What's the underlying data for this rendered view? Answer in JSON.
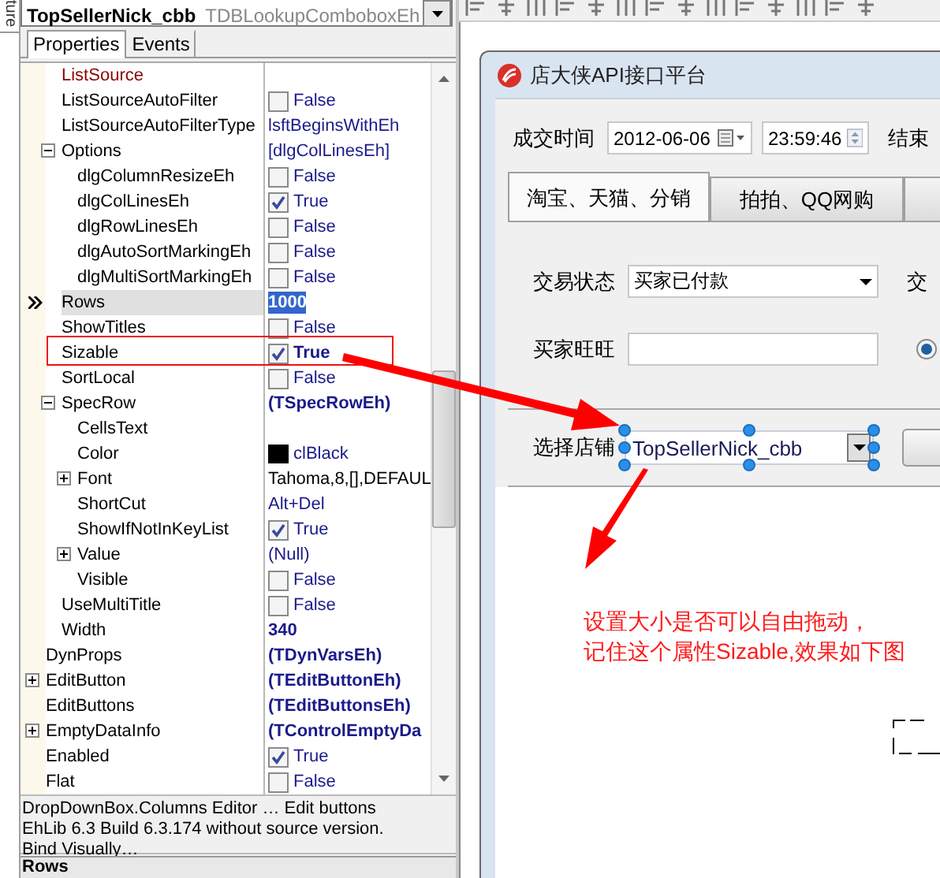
{
  "side_tab": {
    "label": "ture"
  },
  "inspector": {
    "object": "TopSellerNick_cbb",
    "type": "TDBLookupComboboxEh",
    "tabs": [
      {
        "label": "Properties",
        "selected": true
      },
      {
        "label": "Events",
        "selected": false
      }
    ],
    "properties": [
      {
        "children": [
          {
            "name": "ListSource",
            "kind": "link",
            "selected": false
          },
          {
            "name": "ListSourceAutoFilter",
            "kind": "check",
            "checked": false,
            "modified": false,
            "value": "False",
            "selected": false
          },
          {
            "name": "ListSourceAutoFilterType",
            "kind": "text",
            "value": "lsftBeginsWithEh",
            "selected": false
          },
          {
            "name": "Options",
            "kind": "text",
            "value": "[dlgColLinesEh]",
            "expanded": true,
            "selected": false,
            "children": [
              {
                "name": "dlgColumnResizeEh",
                "kind": "check",
                "checked": false,
                "modified": false,
                "value": "False",
                "selected": false
              },
              {
                "name": "dlgColLinesEh",
                "kind": "check",
                "checked": true,
                "modified": false,
                "value": "True",
                "selected": false
              },
              {
                "name": "dlgRowLinesEh",
                "kind": "check",
                "checked": false,
                "modified": false,
                "value": "False",
                "selected": false
              },
              {
                "name": "dlgAutoSortMarkingEh",
                "kind": "check",
                "checked": false,
                "modified": false,
                "value": "False",
                "selected": false
              },
              {
                "name": "dlgMultiSortMarkingEh",
                "kind": "check",
                "checked": false,
                "modified": false,
                "value": "False",
                "selected": false
              }
            ]
          },
          {
            "name": "Rows",
            "kind": "text",
            "value": "1000",
            "selected": true
          },
          {
            "name": "ShowTitles",
            "kind": "check",
            "checked": false,
            "modified": false,
            "value": "False",
            "selected": false
          },
          {
            "name": "Sizable",
            "kind": "check",
            "checked": true,
            "modified": true,
            "value": "True",
            "selected": false
          },
          {
            "name": "SortLocal",
            "kind": "check",
            "checked": false,
            "modified": false,
            "value": "False",
            "selected": false
          },
          {
            "name": "SpecRow",
            "kind": "bold",
            "value": "(TSpecRowEh)",
            "expanded": true,
            "selected": false,
            "children": [
              {
                "name": "CellsText",
                "kind": "text",
                "selected": false
              },
              {
                "name": "Color",
                "kind": "color",
                "value": "clBlack",
                "selected": false
              },
              {
                "name": "Font",
                "kind": "plain",
                "value": "Tahoma,8,[],DEFAUL",
                "expanded": false,
                "selected": false
              },
              {
                "name": "ShortCut",
                "kind": "text",
                "value": "Alt+Del",
                "selected": false
              },
              {
                "name": "ShowIfNotInKeyList",
                "kind": "check",
                "checked": true,
                "modified": false,
                "value": "True",
                "selected": false
              },
              {
                "name": "Value",
                "kind": "text",
                "value": "(Null)",
                "expanded": false,
                "selected": false
              },
              {
                "name": "Visible",
                "kind": "check",
                "checked": false,
                "modified": false,
                "value": "False",
                "selected": false
              }
            ]
          },
          {
            "name": "UseMultiTitle",
            "kind": "check",
            "checked": false,
            "modified": false,
            "value": "False",
            "selected": false
          },
          {
            "name": "Width",
            "kind": "bold",
            "value": "340",
            "selected": false
          }
        ]
      },
      {
        "name": "DynProps",
        "kind": "bold",
        "value": "(TDynVarsEh)",
        "selected": false
      },
      {
        "name": "EditButton",
        "kind": "bold",
        "value": "(TEditButtonEh)",
        "expanded": false,
        "selected": false
      },
      {
        "name": "EditButtons",
        "kind": "bold",
        "value": "(TEditButtonsEh)",
        "selected": false
      },
      {
        "name": "EmptyDataInfo",
        "kind": "bold",
        "value": "(TControlEmptyDa",
        "expanded": false,
        "selected": false
      },
      {
        "name": "Enabled",
        "kind": "check",
        "checked": true,
        "modified": false,
        "value": "True",
        "selected": false
      },
      {
        "name": "Flat",
        "kind": "check",
        "checked": false,
        "modified": false,
        "value": "False",
        "selected": false
      }
    ],
    "description": [
      "DropDownBox.Columns Editor …  Edit buttons",
      "EhLib 6.3 Build 6.3.174 without source version.",
      "Bind Visually…"
    ],
    "footer": "Rows"
  },
  "form": {
    "title": "店大侠API接口平台",
    "deal_time": {
      "label": "成交时间",
      "date": "2012-06-06",
      "time": "23:59:46"
    },
    "end_label": "结束",
    "tabs": [
      {
        "label": "淘宝、天猫、分销",
        "selected": true
      },
      {
        "label": "拍拍、QQ网购",
        "selected": false
      },
      {
        "selected": false
      }
    ],
    "status": {
      "label": "交易状态",
      "value": "买家已付款"
    },
    "trade_label": "交",
    "buyer": {
      "label": "买家旺旺"
    },
    "radio": {
      "selected": true
    },
    "shop": {
      "label": "选择店铺",
      "value": "TopSellerNick_cbb"
    }
  },
  "note": [
    "设置大小是否可以自由拖动，",
    "记住这个属性Sizable,效果如下图"
  ]
}
